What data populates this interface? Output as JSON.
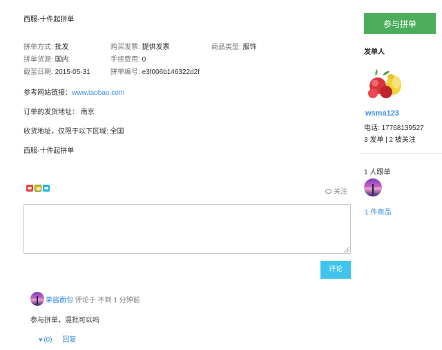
{
  "title": "西服-十件起拼单",
  "meta": {
    "mode_label": "拼单方式:",
    "mode_value": "批发",
    "invoice_label": "购买发票:",
    "invoice_value": "提供发票",
    "type_label": "商品类型:",
    "type_value": "服饰",
    "source_label": "拼单货源:",
    "source_value": "国内",
    "fee_label": "手续费用:",
    "fee_value": "0",
    "deadline_label": "截至日期:",
    "deadline_value": "2015-05-31",
    "id_label": "拼单编号:",
    "id_value": "e3f006b146322d2f"
  },
  "ref_label": "参考网站链接：",
  "ref_url": "www.taobao.com",
  "ship_from": "订单的发货地址： 南京",
  "ship_to": "收货地址，仅限于以下区域: 全国",
  "description": "西服-十件起拼单",
  "follow_label": "关注",
  "comment_button": "评论",
  "comment": {
    "user": "果酱面包",
    "time": "评论于 不到 1 分钟前",
    "text": "参与拼单，混批可以吗",
    "likes": "(0)",
    "reply": "回复"
  },
  "sidebar": {
    "join_button": "参与拼单",
    "host_heading": "发单人",
    "host_name": "wsma123",
    "phone": "电话: 17768139527",
    "stats": "3 发单 | 2 被关注",
    "followers_heading": "1 人跟单",
    "goods_link": "1 件商品"
  },
  "colors": {
    "primary_green": "#4cae5c",
    "accent_blue": "#3fc5ec",
    "link_blue": "#3a8ee6"
  },
  "icons": [
    "weibo-share-icon",
    "qzone-share-icon",
    "tencent-share-icon",
    "eye-icon",
    "heart-icon"
  ]
}
